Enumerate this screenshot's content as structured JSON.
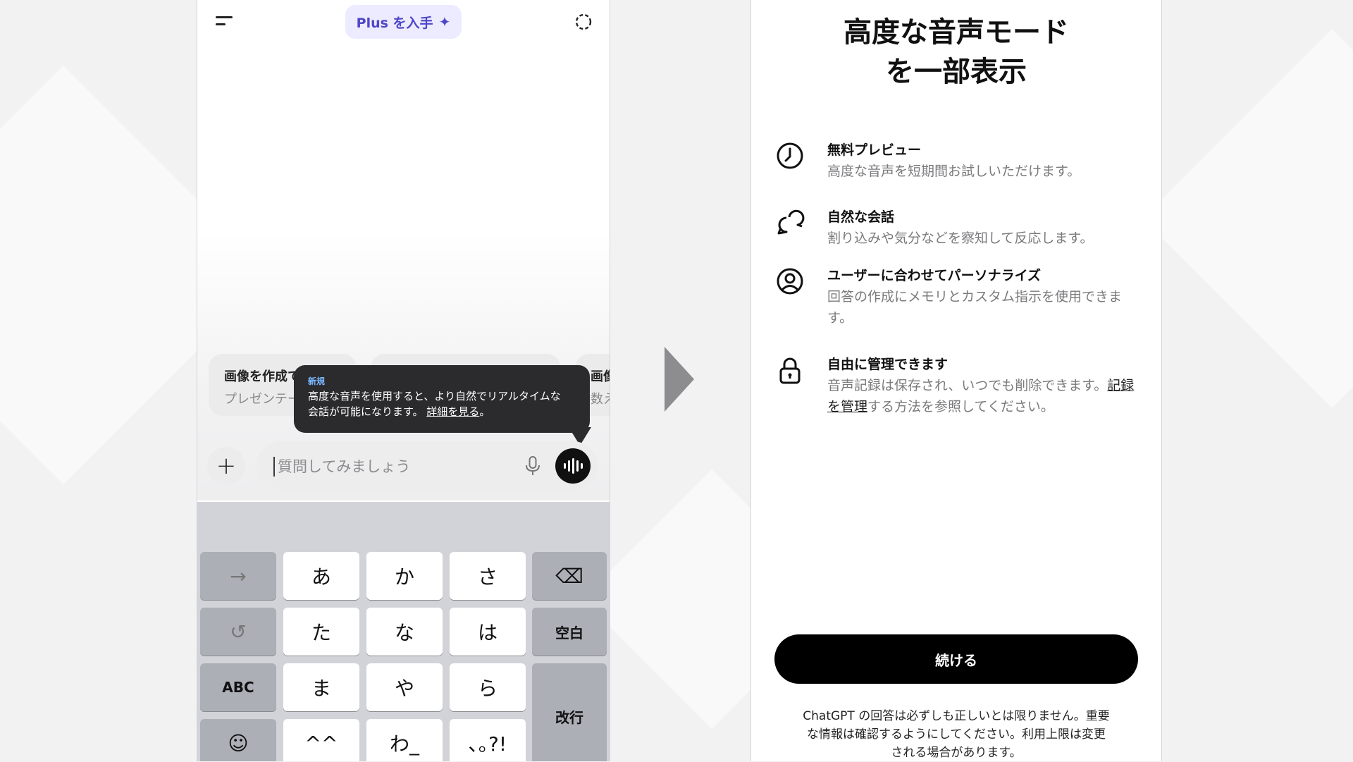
{
  "colors": {
    "accent": "#4f46c8",
    "pill_bg": "#ecebff",
    "tooltip_bg": "#2b2b2d",
    "new_tag": "#7ab8ff",
    "button_bg": "#000000"
  },
  "left": {
    "header": {
      "plus_label": "Plus を入手",
      "plus_icon": "sparkle-icon",
      "menu_icon": "menu-icon",
      "newchat_icon": "new-chat-icon"
    },
    "suggestions": [
      {
        "title": "画像を作成て",
        "subtitle": "プレゼンテー"
      },
      {
        "title": "",
        "subtitle": ""
      },
      {
        "title": "画像",
        "subtitle": "数え"
      }
    ],
    "tooltip": {
      "tag": "新規",
      "line1": "高度な音声を使用すると、より自然でリアルタイムな",
      "line2": "会話が可能になります。",
      "link": "詳細を見る",
      "end": "。"
    },
    "input": {
      "placeholder": "質問してみましょう",
      "add_label": "+"
    },
    "keyboard": {
      "row1": [
        "→",
        "あ",
        "か",
        "さ",
        "⌫"
      ],
      "row2": [
        "↺",
        "た",
        "な",
        "は",
        "空白"
      ],
      "row3": [
        "ABC",
        "ま",
        "や",
        "ら",
        "改行"
      ],
      "row4": [
        "☺",
        "^^",
        "わ_",
        "､｡?!"
      ]
    }
  },
  "right": {
    "title_line1": "高度な音声モード",
    "title_line2": "を一部表示",
    "features": [
      {
        "icon": "clock-icon",
        "title": "無料プレビュー",
        "desc": "高度な音声を短期間お試しいただけます。"
      },
      {
        "icon": "chat-bubbles-icon",
        "title": "自然な会話",
        "desc": "割り込みや気分などを察知して反応します。"
      },
      {
        "icon": "user-circle-icon",
        "title": "ユーザーに合わせてパーソナライズ",
        "desc": "回答の作成にメモリとカスタム指示を使用できます。"
      },
      {
        "icon": "lock-icon",
        "title": "自由に管理できます",
        "desc_pre": "音声記録は保存され、いつでも削除できます。",
        "desc_link": "記録を管理",
        "desc_post": "する方法を参照してください。"
      }
    ],
    "continue_label": "続ける",
    "disclaimer_line1": "ChatGPT の回答は必ずしも正しいとは限りません。重要",
    "disclaimer_line2": "な情報は確認するようにしてください。利用上限は変更",
    "disclaimer_line3": "される場合があります。"
  }
}
